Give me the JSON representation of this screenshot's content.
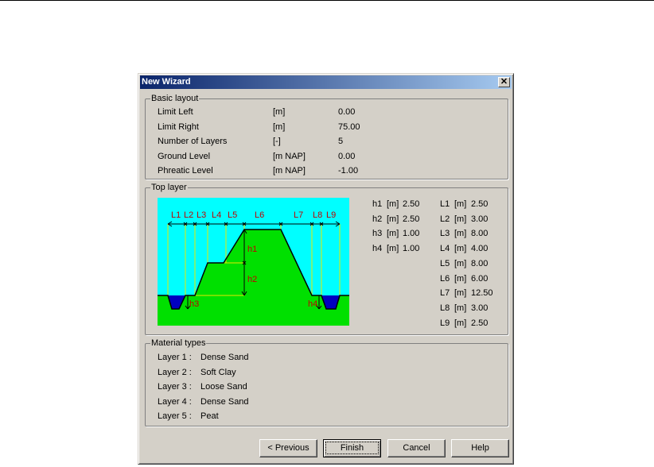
{
  "dialog": {
    "title": "New Wizard",
    "close_glyph": "✕"
  },
  "basic_layout": {
    "title": "Basic layout",
    "rows": [
      {
        "label": "Limit Left",
        "unit": "[m]",
        "value": "0.00"
      },
      {
        "label": "Limit Right",
        "unit": "[m]",
        "value": "75.00"
      },
      {
        "label": "Number of Layers",
        "unit": "[-]",
        "value": "5"
      },
      {
        "label": "Ground Level",
        "unit": "[m NAP]",
        "value": "0.00"
      },
      {
        "label": "Phreatic Level",
        "unit": "[m NAP]",
        "value": "-1.00"
      }
    ]
  },
  "top_layer": {
    "title": "Top layer",
    "colors": {
      "sky": "#00ffff",
      "ground": "#00e000",
      "water": "#0000c0",
      "label": "#c00000"
    },
    "diagram_labels": {
      "L1": "L1",
      "L2": "L2",
      "L3": "L3",
      "L4": "L4",
      "L5": "L5",
      "L6": "L6",
      "L7": "L7",
      "L8": "L8",
      "L9": "L9",
      "h1": "h1",
      "h2": "h2",
      "h3": "h3",
      "h4": "h4"
    },
    "h_params": [
      {
        "name": "h1",
        "unit": "[m]",
        "value": "2.50"
      },
      {
        "name": "h2",
        "unit": "[m]",
        "value": "2.50"
      },
      {
        "name": "h3",
        "unit": "[m]",
        "value": "1.00"
      },
      {
        "name": "h4",
        "unit": "[m]",
        "value": "1.00"
      }
    ],
    "l_params": [
      {
        "name": "L1",
        "unit": "[m]",
        "value": "2.50"
      },
      {
        "name": "L2",
        "unit": "[m]",
        "value": "3.00"
      },
      {
        "name": "L3",
        "unit": "[m]",
        "value": "8.00"
      },
      {
        "name": "L4",
        "unit": "[m]",
        "value": "4.00"
      },
      {
        "name": "L5",
        "unit": "[m]",
        "value": "8.00"
      },
      {
        "name": "L6",
        "unit": "[m]",
        "value": "6.00"
      },
      {
        "name": "L7",
        "unit": "[m]",
        "value": "12.50"
      },
      {
        "name": "L8",
        "unit": "[m]",
        "value": "3.00"
      },
      {
        "name": "L9",
        "unit": "[m]",
        "value": "2.50"
      }
    ]
  },
  "material_types": {
    "title": "Material types",
    "layers": [
      {
        "label": "Layer 1 :",
        "material": "Dense Sand"
      },
      {
        "label": "Layer 2 :",
        "material": "Soft Clay"
      },
      {
        "label": "Layer 3 :",
        "material": "Loose Sand"
      },
      {
        "label": "Layer 4 :",
        "material": "Dense Sand"
      },
      {
        "label": "Layer 5 :",
        "material": "Peat"
      }
    ]
  },
  "buttons": {
    "previous": "< Previous",
    "finish": "Finish",
    "cancel": "Cancel",
    "help": "Help"
  }
}
